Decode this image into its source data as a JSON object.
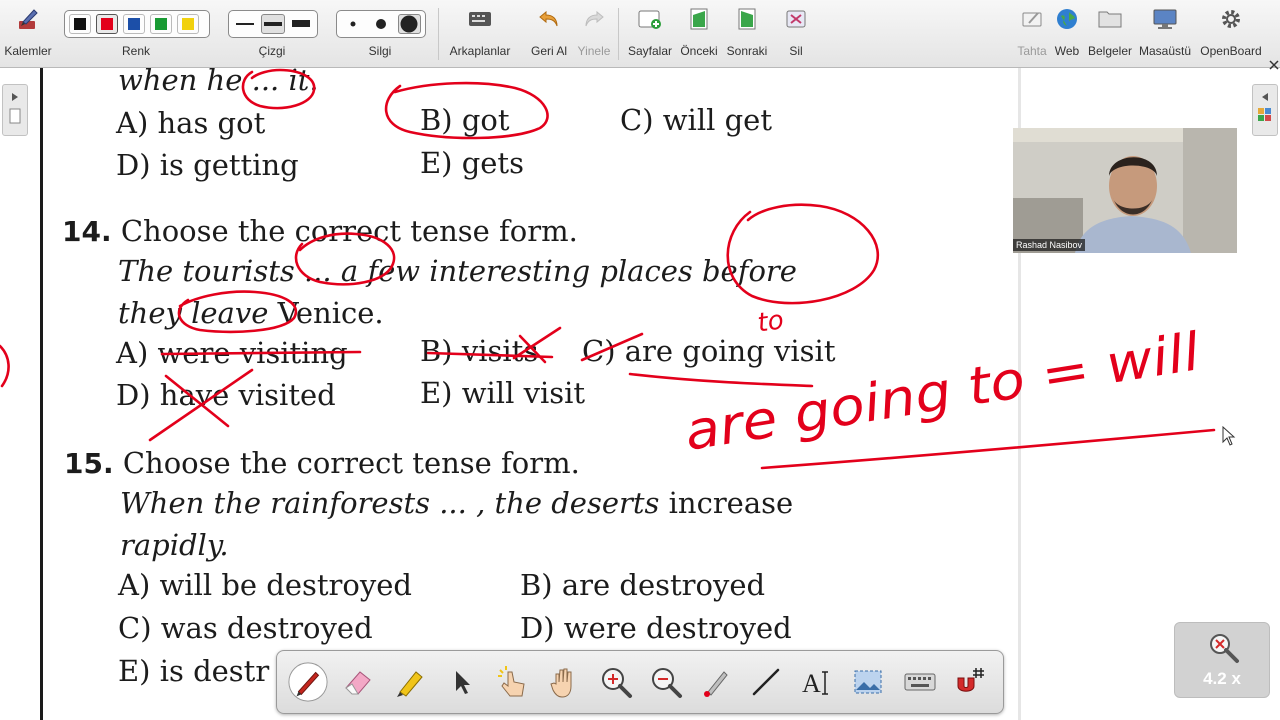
{
  "toolbar": {
    "pens_label": "Kalemler",
    "color_label": "Renk",
    "line_label": "Çizgi",
    "eraser_label": "Silgi",
    "backgrounds_label": "Arkaplanlar",
    "undo_label": "Geri Al",
    "redo_label": "Yinele",
    "pages_label": "Sayfalar",
    "previous_label": "Önceki",
    "next_label": "Sonraki",
    "delete_label": "Sil",
    "board_label": "Tahta",
    "web_label": "Web",
    "documents_label": "Belgeler",
    "desktop_label": "Masaüstü",
    "openboard_label": "OpenBoard",
    "colors": [
      "#111111",
      "#e3001b",
      "#1c4fa8",
      "#189a33",
      "#f1d10d"
    ],
    "selected_color": "#e3001b"
  },
  "document": {
    "q13_tail": "when he ... it.",
    "q13_options": {
      "a": "A) has got",
      "b": "B) got",
      "c": "C) will get",
      "d": "D) is getting",
      "e": "E) gets"
    },
    "q14": {
      "number": "14.",
      "prompt": "Choose the correct tense form.",
      "sentence_line1": "The tourists ... a few interesting places before",
      "sentence_line2_a": "they leave",
      "sentence_line2_b": " Venice.",
      "options": {
        "a": "A) were visiting",
        "b": "B) visits",
        "c": "C) are going visit",
        "d": "D) have visited",
        "e": "E) will visit"
      }
    },
    "q15": {
      "number": "15.",
      "prompt": "Choose the correct tense form.",
      "sentence_line1_a": "When the rainforests ... , the deserts",
      "sentence_line1_b": " increase",
      "sentence_line2": "rapidly.",
      "options": {
        "a": "A) will be destroyed",
        "b": "B) are destroyed",
        "c": "C) was destroyed",
        "d": "D) were destroyed",
        "e": "E) is destr"
      }
    }
  },
  "annotations": {
    "ink_color": "#e3001b",
    "handwriting_to": "to",
    "handwriting_main": "are going to = will"
  },
  "webcam": {
    "name": "Rashad Nasibov"
  },
  "zoom": {
    "level": "4.2 x"
  }
}
